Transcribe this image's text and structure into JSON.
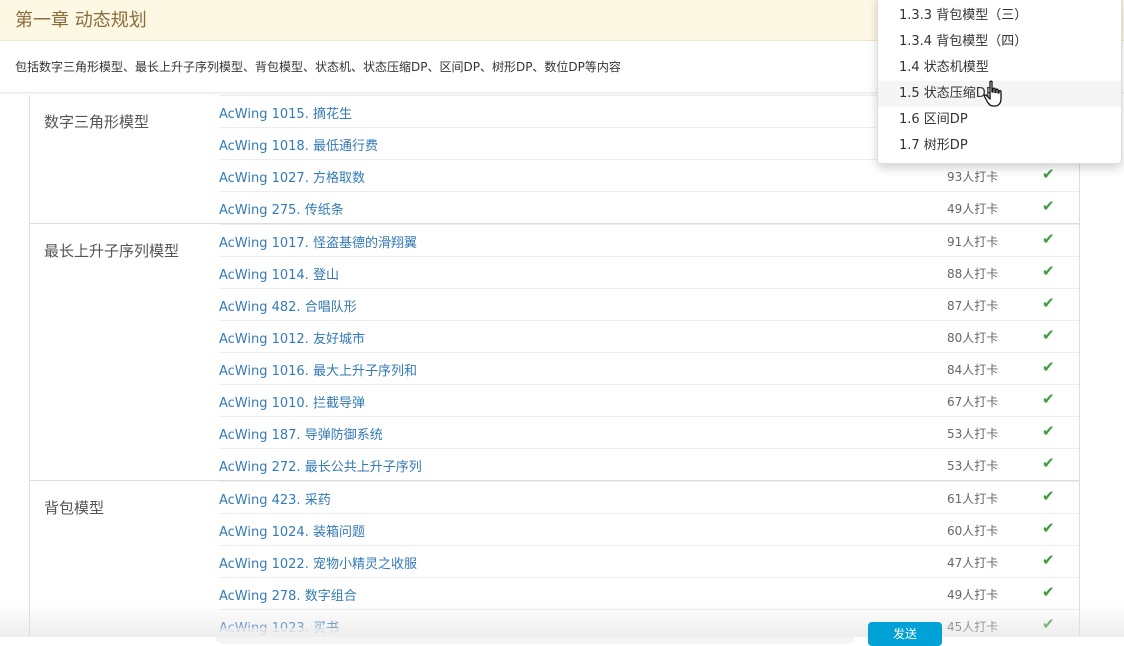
{
  "chapter": {
    "title": "第一章 动态规划",
    "description": "包括数字三角形模型、最长上升子序列模型、背包模型、状态机、状态压缩DP、区间DP、树形DP、数位DP等内容"
  },
  "groups": [
    {
      "title": "数字三角形模型",
      "problems": [
        {
          "name": "AcWing 1015. 摘花生",
          "checkins": "",
          "done": false
        },
        {
          "name": "AcWing 1018. 最低通行费",
          "checkins": "",
          "done": false
        },
        {
          "name": "AcWing 1027. 方格取数",
          "checkins": "93人打卡",
          "done": true
        },
        {
          "name": "AcWing 275. 传纸条",
          "checkins": "49人打卡",
          "done": true
        }
      ]
    },
    {
      "title": "最长上升子序列模型",
      "problems": [
        {
          "name": "AcWing 1017. 怪盗基德的滑翔翼",
          "checkins": "91人打卡",
          "done": true
        },
        {
          "name": "AcWing 1014. 登山",
          "checkins": "88人打卡",
          "done": true
        },
        {
          "name": "AcWing 482. 合唱队形",
          "checkins": "87人打卡",
          "done": true
        },
        {
          "name": "AcWing 1012. 友好城市",
          "checkins": "80人打卡",
          "done": true
        },
        {
          "name": "AcWing 1016. 最大上升子序列和",
          "checkins": "84人打卡",
          "done": true
        },
        {
          "name": "AcWing 1010. 拦截导弹",
          "checkins": "67人打卡",
          "done": true
        },
        {
          "name": "AcWing 187. 导弹防御系统",
          "checkins": "53人打卡",
          "done": true
        },
        {
          "name": "AcWing 272. 最长公共上升子序列",
          "checkins": "53人打卡",
          "done": true
        }
      ]
    },
    {
      "title": "背包模型",
      "problems": [
        {
          "name": "AcWing 423. 采药",
          "checkins": "61人打卡",
          "done": true
        },
        {
          "name": "AcWing 1024. 装箱问题",
          "checkins": "60人打卡",
          "done": true
        },
        {
          "name": "AcWing 1022. 宠物小精灵之收服",
          "checkins": "47人打卡",
          "done": true
        },
        {
          "name": "AcWing 278. 数字组合",
          "checkins": "49人打卡",
          "done": true
        },
        {
          "name": "AcWing 1023. 买书",
          "checkins": "45人打卡",
          "done": true
        }
      ]
    }
  ],
  "dropdown": {
    "items": [
      {
        "label": "1.3.3 背包模型（三）",
        "active": false
      },
      {
        "label": "1.3.4 背包模型（四）",
        "active": false
      },
      {
        "label": "1.4 状态机模型",
        "active": false
      },
      {
        "label": "1.5 状态压缩DP",
        "active": true
      },
      {
        "label": "1.6 区间DP",
        "active": false
      },
      {
        "label": "1.7 树形DP",
        "active": false
      }
    ]
  },
  "player": {
    "send_label": "发送"
  },
  "icons": {
    "check": "check-icon",
    "cursor": "hand-pointer-icon"
  },
  "colors": {
    "link": "#337ab7",
    "check": "#3c9d3c",
    "header_bg": "#fcf8e3",
    "header_text": "#8a6d3b",
    "send_button": "#00a1d6"
  }
}
